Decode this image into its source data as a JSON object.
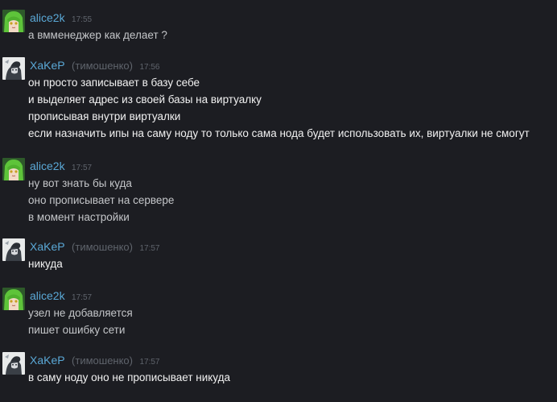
{
  "messages": [
    {
      "author": "alice2k",
      "nick": "",
      "time": "17:55",
      "avatar": "alice-avatar-icon",
      "lines": [
        "а вмменеджер как делает ?"
      ]
    },
    {
      "author": "XaKeP",
      "nick": "(тимошенко)",
      "time": "17:56",
      "avatar": "xaker-avatar-icon",
      "lines": [
        "он просто записывает в базу себе",
        "и выделяет адрес из своей базы на виртуалку",
        "прописывая внутри виртуалки",
        "если назначить ипы на саму ноду то только сама нода будет использовать их, виртуалки не смогут"
      ]
    },
    {
      "author": "alice2k",
      "nick": "",
      "time": "17:57",
      "avatar": "alice-avatar-icon",
      "lines": [
        "ну вот знать бы куда",
        "оно прописывает на сервере",
        "в момент настройки"
      ]
    },
    {
      "author": "XaKeP",
      "nick": "(тимошенко)",
      "time": "17:57",
      "avatar": "xaker-avatar-icon",
      "lines": [
        "никуда"
      ]
    },
    {
      "author": "alice2k",
      "nick": "",
      "time": "17:57",
      "avatar": "alice-avatar-icon",
      "lines": [
        "узел не добавляется",
        "пишет ошибку сети"
      ]
    },
    {
      "author": "XaKeP",
      "nick": "(тимошенко)",
      "time": "17:57",
      "avatar": "xaker-avatar-icon",
      "lines": [
        "в саму ноду оно не прописывает никуда"
      ]
    }
  ]
}
